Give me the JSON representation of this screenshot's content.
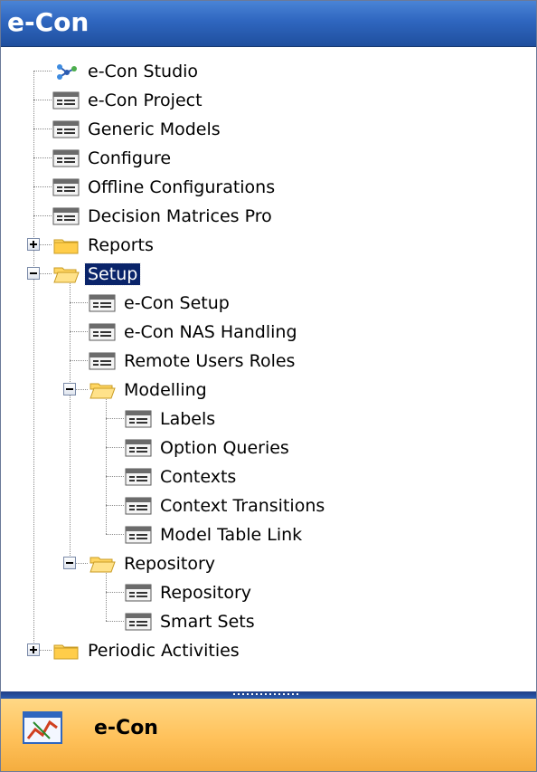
{
  "header": {
    "title": "e-Con"
  },
  "tree": {
    "items": [
      {
        "label": "e-Con Studio",
        "icon": "network-icon",
        "level": 0
      },
      {
        "label": "e-Con Project",
        "icon": "form-icon",
        "level": 0
      },
      {
        "label": "Generic Models",
        "icon": "form-icon",
        "level": 0
      },
      {
        "label": "Configure",
        "icon": "form-icon",
        "level": 0
      },
      {
        "label": "Offline Configurations",
        "icon": "form-icon",
        "level": 0
      },
      {
        "label": "Decision Matrices Pro",
        "icon": "form-icon",
        "level": 0
      },
      {
        "label": "Reports",
        "icon": "folder-closed-icon",
        "level": 0,
        "expander": "plus"
      },
      {
        "label": "Setup",
        "icon": "folder-open-icon",
        "level": 0,
        "expander": "minus",
        "selected": true
      },
      {
        "label": "e-Con Setup",
        "icon": "form-icon",
        "level": 1
      },
      {
        "label": "e-Con NAS Handling",
        "icon": "form-icon",
        "level": 1
      },
      {
        "label": "Remote Users Roles",
        "icon": "form-icon",
        "level": 1
      },
      {
        "label": "Modelling",
        "icon": "folder-open-icon",
        "level": 1,
        "expander": "minus"
      },
      {
        "label": "Labels",
        "icon": "form-icon",
        "level": 2
      },
      {
        "label": "Option Queries",
        "icon": "form-icon",
        "level": 2
      },
      {
        "label": "Contexts",
        "icon": "form-icon",
        "level": 2
      },
      {
        "label": "Context Transitions",
        "icon": "form-icon",
        "level": 2
      },
      {
        "label": "Model Table Link",
        "icon": "form-icon",
        "level": 2
      },
      {
        "label": "Repository",
        "icon": "folder-open-icon",
        "level": 1,
        "expander": "minus"
      },
      {
        "label": "Repository",
        "icon": "form-icon",
        "level": 2
      },
      {
        "label": "Smart Sets",
        "icon": "form-icon",
        "level": 2
      },
      {
        "label": "Periodic Activities",
        "icon": "folder-closed-icon",
        "level": 0,
        "expander": "plus"
      }
    ]
  },
  "footer": {
    "label": "e-Con",
    "icon": "econ-app-icon"
  },
  "colors": {
    "header": "#2f66bf",
    "selection": "#0a246a",
    "footer": "#ffc15a",
    "splitter": "#1f3f86"
  }
}
